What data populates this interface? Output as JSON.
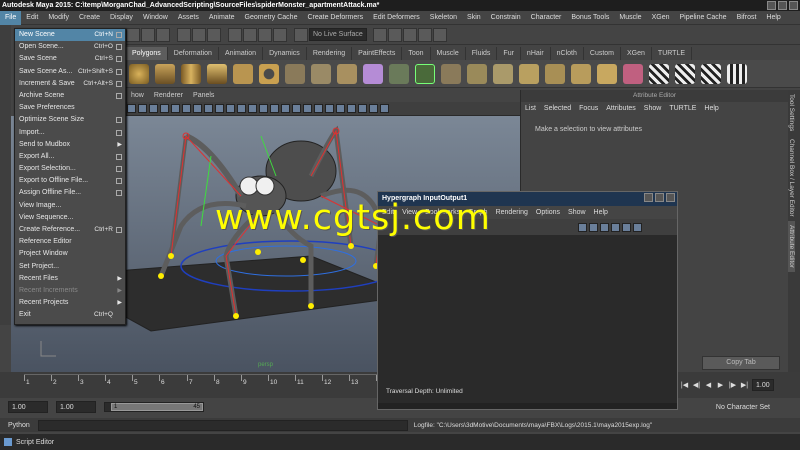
{
  "window": {
    "title": "Autodesk Maya 2015: C:\\temp\\MorganChad_AdvancedScripting\\SourceFiles\\spiderMonster_apartmentAttack.ma*"
  },
  "menubar": [
    "File",
    "Edit",
    "Modify",
    "Create",
    "Display",
    "Window",
    "Assets",
    "Animate",
    "Geometry Cache",
    "Create Deformers",
    "Edit Deformers",
    "Skeleton",
    "Skin",
    "Constrain",
    "Character",
    "Bonus Tools",
    "Muscle",
    "XGen",
    "Pipeline Cache",
    "Bifrost",
    "Help"
  ],
  "status_line": {
    "live_surface": "No Live Surface"
  },
  "shelf_tabs": [
    "Polygons",
    "Deformation",
    "Animation",
    "Dynamics",
    "Rendering",
    "PaintEffects",
    "Toon",
    "Muscle",
    "Fluids",
    "Fur",
    "nHair",
    "nCloth",
    "Custom",
    "XGen",
    "TURTLE"
  ],
  "shelf_tab_selected": "Polygons",
  "viewport_menu": [
    "how",
    "Renderer",
    "Panels"
  ],
  "viewport_label": "persp",
  "file_menu": [
    {
      "label": "New Scene",
      "shortcut": "Ctrl+N",
      "option": true,
      "highlight": true
    },
    {
      "label": "Open Scene...",
      "shortcut": "Ctrl+O",
      "option": true
    },
    {
      "label": "Save Scene",
      "shortcut": "Ctrl+S",
      "option": true
    },
    {
      "label": "Save Scene As...",
      "shortcut": "Ctrl+Shift+S",
      "option": true
    },
    {
      "label": "Increment & Save",
      "shortcut": "Ctrl+Alt+S",
      "option": true
    },
    {
      "label": "Archive Scene",
      "shortcut": "",
      "option": true
    },
    {
      "label": "Save Preferences",
      "shortcut": "",
      "option": false
    },
    {
      "label": "Optimize Scene Size",
      "shortcut": "",
      "option": true
    },
    {
      "label": "Import...",
      "shortcut": "",
      "option": true
    },
    {
      "label": "Send to Mudbox",
      "shortcut": "",
      "submenu": true
    },
    {
      "label": "Export All...",
      "shortcut": "",
      "option": true
    },
    {
      "label": "Export Selection...",
      "shortcut": "",
      "option": true
    },
    {
      "label": "Export to Offline File...",
      "shortcut": "",
      "option": true
    },
    {
      "label": "Assign Offline File...",
      "shortcut": "",
      "option": true
    },
    {
      "label": "View Image...",
      "shortcut": "",
      "option": false
    },
    {
      "label": "View Sequence...",
      "shortcut": "",
      "option": false
    },
    {
      "label": "Create Reference...",
      "shortcut": "Ctrl+R",
      "option": true
    },
    {
      "label": "Reference Editor",
      "shortcut": "",
      "option": false
    },
    {
      "label": "Project Window",
      "shortcut": "",
      "option": false
    },
    {
      "label": "Set Project...",
      "shortcut": "",
      "option": false
    },
    {
      "label": "Recent Files",
      "shortcut": "",
      "submenu": true
    },
    {
      "label": "Recent Increments",
      "shortcut": "",
      "submenu": true,
      "disabled": true
    },
    {
      "label": "Recent Projects",
      "shortcut": "",
      "submenu": true
    },
    {
      "label": "Exit",
      "shortcut": "Ctrl+Q",
      "option": false
    }
  ],
  "attribute_editor": {
    "title": "Attribute Editor",
    "menu": [
      "List",
      "Selected",
      "Focus",
      "Attributes",
      "Show",
      "TURTLE",
      "Help"
    ],
    "message": "Make a selection to view attributes",
    "copy_tab": "Copy Tab"
  },
  "side_tabs": [
    "Tool Settings",
    "Channel Box / Layer Editor",
    "Attribute Editor"
  ],
  "side_tab_selected": "Attribute Editor",
  "hypergraph": {
    "title": "Hypergraph InputOutput1",
    "menu": [
      "Edit",
      "View",
      "Bookmarks",
      "Graph",
      "Rendering",
      "Options",
      "Show",
      "Help"
    ],
    "depth": "Traversal Depth: Unlimited"
  },
  "timeline": {
    "ticks": [
      "1",
      "2",
      "3",
      "4",
      "5",
      "6",
      "7",
      "8",
      "9",
      "10",
      "11",
      "12",
      "13",
      "14",
      "15",
      "16",
      "17",
      "18",
      "19",
      "20",
      "21",
      "22",
      "23",
      "24"
    ],
    "current_frame": "1.00"
  },
  "range": {
    "start": "1.00",
    "current": "1.00",
    "slider_start": "1",
    "slider_end": "45",
    "character_set": "No Character Set"
  },
  "command_line": {
    "label": "Python",
    "log": "Logfile: \"C:\\Users\\3dMotive\\Documents\\maya\\FBX\\Logs\\2015.1\\maya2015exp.log\""
  },
  "taskbar": {
    "item": "Script Editor"
  },
  "watermark": "www.cgtsj.com"
}
